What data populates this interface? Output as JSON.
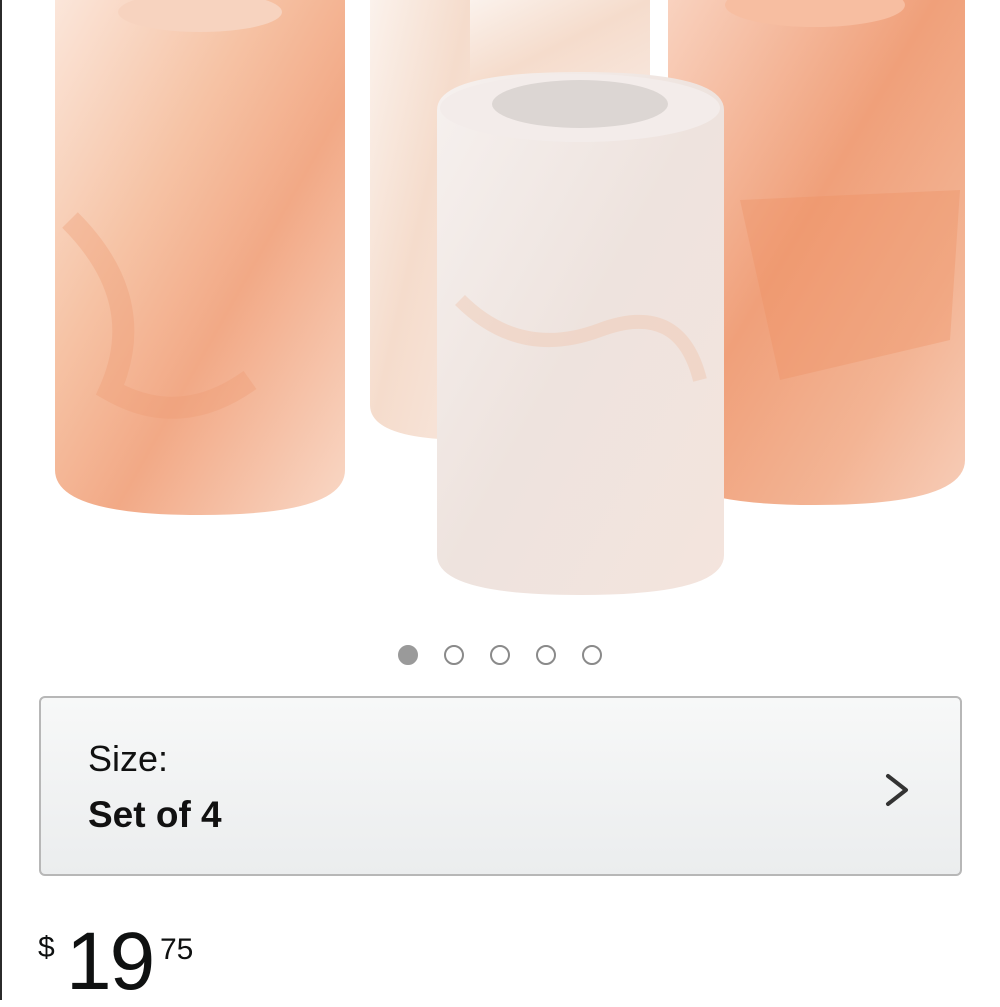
{
  "product": {
    "image_alt": "Himalayan salt shot glasses",
    "carousel": {
      "count": 5,
      "active_index": 0
    }
  },
  "size_selector": {
    "label": "Size:",
    "value": "Set of 4",
    "chevron_icon": "chevron-right-icon"
  },
  "price": {
    "currency": "$",
    "whole": "19",
    "fraction": "75"
  },
  "colors": {
    "salt_pink": "#f2a57d",
    "salt_white": "#f3ecea",
    "dot_active": "#9a9a9a",
    "border": "#b7b7b7"
  }
}
